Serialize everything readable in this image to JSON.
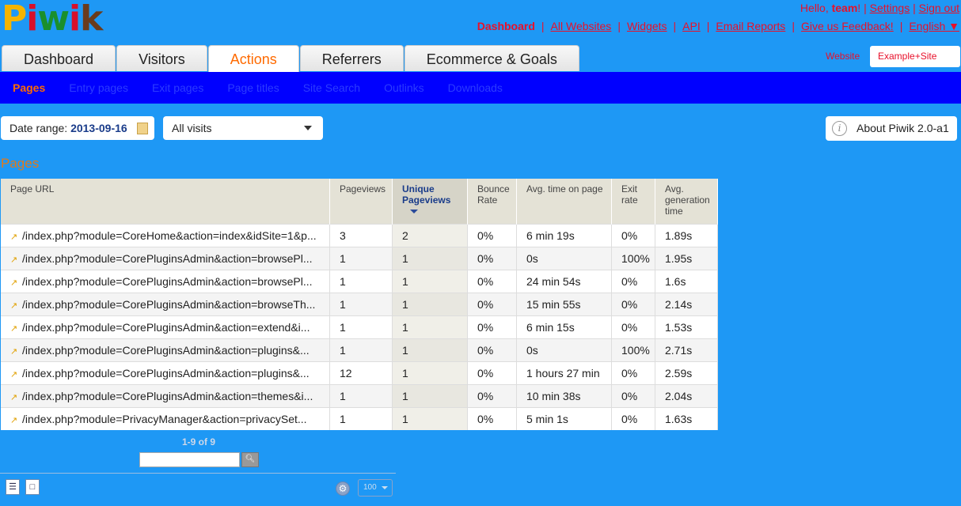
{
  "logo": [
    "P",
    "i",
    "w",
    "i",
    "k"
  ],
  "user": {
    "greeting": "Hello,",
    "name": "team",
    "suffix": "!",
    "settings": "Settings",
    "signout": "Sign out"
  },
  "topnav": [
    "Dashboard",
    "All Websites",
    "Widgets",
    "API",
    "Email Reports",
    "Give us Feedback!",
    "English ▼"
  ],
  "tabs": [
    "Dashboard",
    "Visitors",
    "Actions",
    "Referrers",
    "Ecommerce & Goals"
  ],
  "site": {
    "label": "Website",
    "value": "Example+Site"
  },
  "subnav": [
    "Pages",
    "Entry pages",
    "Exit pages",
    "Page titles",
    "Site Search",
    "Outlinks",
    "Downloads"
  ],
  "date": {
    "label": "Date range:",
    "value": "2013-09-16"
  },
  "segment": "All visits",
  "about": "About Piwik 2.0-a1",
  "section_title": "Pages",
  "columns": [
    "Page URL",
    "Pageviews",
    "Unique Pageviews",
    "Bounce Rate",
    "Avg. time on page",
    "Exit rate",
    "Avg. generation time"
  ],
  "rows": [
    [
      "/index.php?module=CoreHome&action=index&idSite=1&p...",
      "3",
      "2",
      "0%",
      "6 min 19s",
      "0%",
      "1.89s"
    ],
    [
      "/index.php?module=CorePluginsAdmin&action=browsePl...",
      "1",
      "1",
      "0%",
      "0s",
      "100%",
      "1.95s"
    ],
    [
      "/index.php?module=CorePluginsAdmin&action=browsePl...",
      "1",
      "1",
      "0%",
      "24 min 54s",
      "0%",
      "1.6s"
    ],
    [
      "/index.php?module=CorePluginsAdmin&action=browseTh...",
      "1",
      "1",
      "0%",
      "15 min 55s",
      "0%",
      "2.14s"
    ],
    [
      "/index.php?module=CorePluginsAdmin&action=extend&i...",
      "1",
      "1",
      "0%",
      "6 min 15s",
      "0%",
      "1.53s"
    ],
    [
      "/index.php?module=CorePluginsAdmin&action=plugins&...",
      "1",
      "1",
      "0%",
      "0s",
      "100%",
      "2.71s"
    ],
    [
      "/index.php?module=CorePluginsAdmin&action=plugins&...",
      "12",
      "1",
      "0%",
      "1 hours 27 min",
      "0%",
      "2.59s"
    ],
    [
      "/index.php?module=CorePluginsAdmin&action=themes&i...",
      "1",
      "1",
      "0%",
      "10 min 38s",
      "0%",
      "2.04s"
    ],
    [
      "/index.php?module=PrivacyManager&action=privacySet...",
      "1",
      "1",
      "0%",
      "5 min 1s",
      "0%",
      "1.63s"
    ]
  ],
  "pager": "1-9 of 9",
  "limit": "100",
  "colors": {
    "background": "#1e98f5",
    "subnav": "#0000ff",
    "accent": "#ff6a00",
    "links": "#e8102a"
  },
  "icons": [
    "calendar-icon",
    "dropdown-arrow-icon",
    "info-icon",
    "external-link-icon",
    "search-icon",
    "table-icon",
    "export-icon",
    "gear-icon"
  ]
}
